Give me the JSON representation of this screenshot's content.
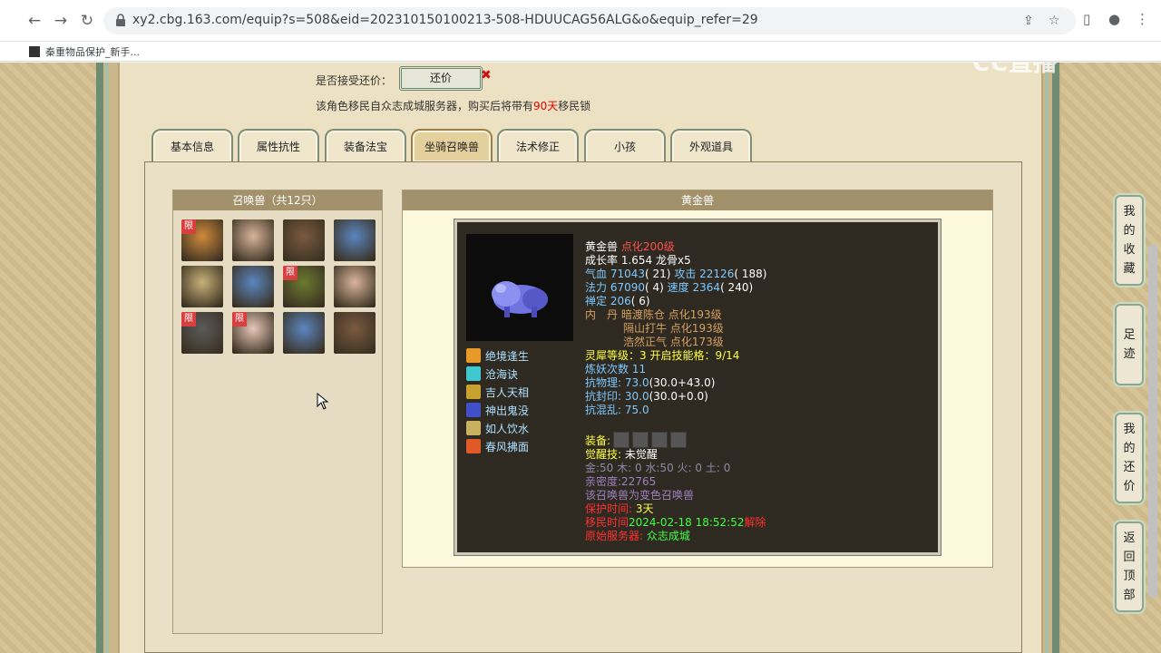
{
  "browser": {
    "url": "xy2.cbg.163.com/equip?s=508&eid=202310150100213-508-HDUUCAG56ALG&o&equip_refer=29",
    "bookmark_label": "秦重物品保护_新手..."
  },
  "watermark": "CC直播",
  "offer": {
    "label": "是否接受还价：",
    "button": "还价",
    "x_mark": "✖"
  },
  "notice": {
    "prefix": "该角色移民自众志成城服务器，购买后将带有",
    "days": "90天",
    "suffix": "移民锁"
  },
  "tabs": [
    "基本信息",
    "属性抗性",
    "装备法宝",
    "坐骑召唤兽",
    "法术修正",
    "小孩",
    "外观道具"
  ],
  "active_tab": "坐骑召唤兽",
  "pet_list": {
    "header": "召唤兽（共12只）",
    "pets": [
      {
        "limited": true,
        "color": "#d08a3a"
      },
      {
        "limited": false,
        "color": "#d8b49a"
      },
      {
        "limited": false,
        "color": "#7a5a40"
      },
      {
        "limited": false,
        "color": "#5a86c0"
      },
      {
        "limited": false,
        "color": "#c8b078"
      },
      {
        "limited": false,
        "color": "#5a86c0"
      },
      {
        "limited": true,
        "color": "#6a7a30"
      },
      {
        "limited": false,
        "color": "#d8b49a"
      },
      {
        "limited": true,
        "color": "#5a5a5a"
      },
      {
        "limited": true,
        "color": "#e8c8b8"
      },
      {
        "limited": false,
        "color": "#5a86c0"
      },
      {
        "limited": false,
        "color": "#7a5a40"
      }
    ],
    "limit_label": "限"
  },
  "detail": {
    "header": "黄金兽",
    "name": "黄金兽",
    "level": "点化200级",
    "growth": "成长率 1.654 龙骨x5",
    "stats": [
      {
        "k1": "气血",
        "v1": "71043",
        "p1": "( 21)",
        "k2": "攻击",
        "v2": "22126",
        "p2": "( 188)"
      },
      {
        "k1": "法力",
        "v1": "67090",
        "p1": "( 4)",
        "k2": "速度",
        "v2": "2364",
        "p2": "( 240)"
      }
    ],
    "chanding": {
      "k": "禅定",
      "v": "206",
      "p": "( 6)"
    },
    "neidan_label": "内　丹",
    "neidan": [
      {
        "name": "暗渡陈仓",
        "level": "点化193级"
      },
      {
        "name": "隔山打牛",
        "level": "点化193级"
      },
      {
        "name": "浩然正气",
        "level": "点化173级"
      }
    ],
    "lingxi": "灵犀等级：3 开启技能格：9/14",
    "lianyao": "炼妖次数 11",
    "resist": [
      {
        "label": "抗物理:",
        "total": "73.0",
        "detail": "(30.0+43.0)"
      },
      {
        "label": "抗封印:",
        "total": "30.0",
        "detail": "(30.0+0.0)"
      },
      {
        "label": "抗混乱:",
        "total": "75.0",
        "detail": ""
      }
    ],
    "equip_label": "装备:",
    "awaken_label": "觉醒技:",
    "awaken_value": "未觉醒",
    "elements": "金:50 木: 0 水:50 火: 0 土: 0",
    "intimacy": "亲密度:22765",
    "color_note": "该召唤兽为变色召唤兽",
    "protect_label": "保护时间:",
    "protect_value": "3天",
    "migrate_label": "移民时间",
    "migrate_value": "2024-02-18 18:52:52",
    "migrate_suffix": "解除",
    "origin_label": "原始服务器:",
    "origin_value": "众志成城",
    "skills": [
      {
        "name": "绝境逢生",
        "color": "#e89a28"
      },
      {
        "name": "沧海诀",
        "color": "#40c8d0"
      },
      {
        "name": "吉人天相",
        "color": "#c8a030"
      },
      {
        "name": "神出鬼没",
        "color": "#4050c8"
      },
      {
        "name": "如人饮水",
        "color": "#c8b060"
      },
      {
        "name": "春风拂面",
        "color": "#e05a28"
      }
    ]
  },
  "side_nav": [
    {
      "label": "我的收藏",
      "chars": [
        "我",
        "的",
        "收",
        "藏"
      ]
    },
    {
      "label": "足迹",
      "chars": [
        "足",
        "迹"
      ]
    },
    {
      "label": "我的还价",
      "chars": [
        "我",
        "的",
        "还",
        "价"
      ]
    },
    {
      "label": "返回顶部",
      "chars": [
        "返",
        "回",
        "顶",
        "部"
      ]
    }
  ]
}
